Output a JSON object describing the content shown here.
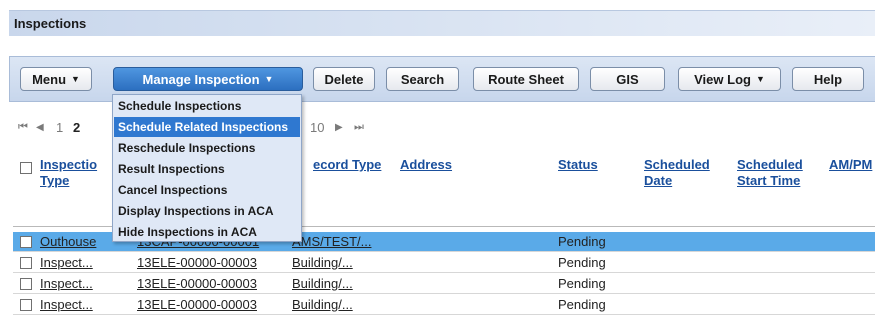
{
  "page": {
    "title": "Inspections"
  },
  "toolbar": {
    "menu": "Menu",
    "manage_inspection": "Manage Inspection",
    "delete": "Delete",
    "search": "Search",
    "route_sheet": "Route Sheet",
    "gis": "GIS",
    "view_log": "View Log",
    "help": "Help",
    "caret": "▼"
  },
  "dropdown": {
    "items": [
      "Schedule Inspections",
      "Schedule Related Inspections",
      "Reschedule Inspections",
      "Result Inspections",
      "Cancel Inspections",
      "Display Inspections in ACA",
      "Hide Inspections in ACA"
    ],
    "highlighted_index": 1
  },
  "pager": {
    "first": "⏮",
    "prev": "◀",
    "page1": "1",
    "page2": "2",
    "page10": "10",
    "next": "▶",
    "last": "⏭"
  },
  "table": {
    "headers": {
      "inspection_type_line1": "Inspectio",
      "inspection_type_line2": "Type",
      "record_type": "ecord Type",
      "address": "Address",
      "status": "Status",
      "scheduled_date_line1": "Scheduled",
      "scheduled_date_line2": "Date",
      "scheduled_start_line1": "Scheduled",
      "scheduled_start_line2": "Start Time",
      "ampm": "AM/PM"
    },
    "rows": [
      {
        "type": "Outhouse",
        "record": "13CAP-00000-00001",
        "record_type": "AMS/TEST/...",
        "status": "Pending"
      },
      {
        "type": "Inspect...",
        "record": "13ELE-00000-00003",
        "record_type": "Building/...",
        "status": "Pending"
      },
      {
        "type": "Inspect...",
        "record": "13ELE-00000-00003",
        "record_type": "Building/...",
        "status": "Pending"
      },
      {
        "type": "Inspect...",
        "record": "13ELE-00000-00003",
        "record_type": "Building/...",
        "status": "Pending"
      }
    ]
  },
  "colors": {
    "header_link": "#1a4f9c",
    "selected_row": "#5aaae8",
    "menu_highlight": "#2f78d0",
    "active_button": "#2c6fc0"
  }
}
